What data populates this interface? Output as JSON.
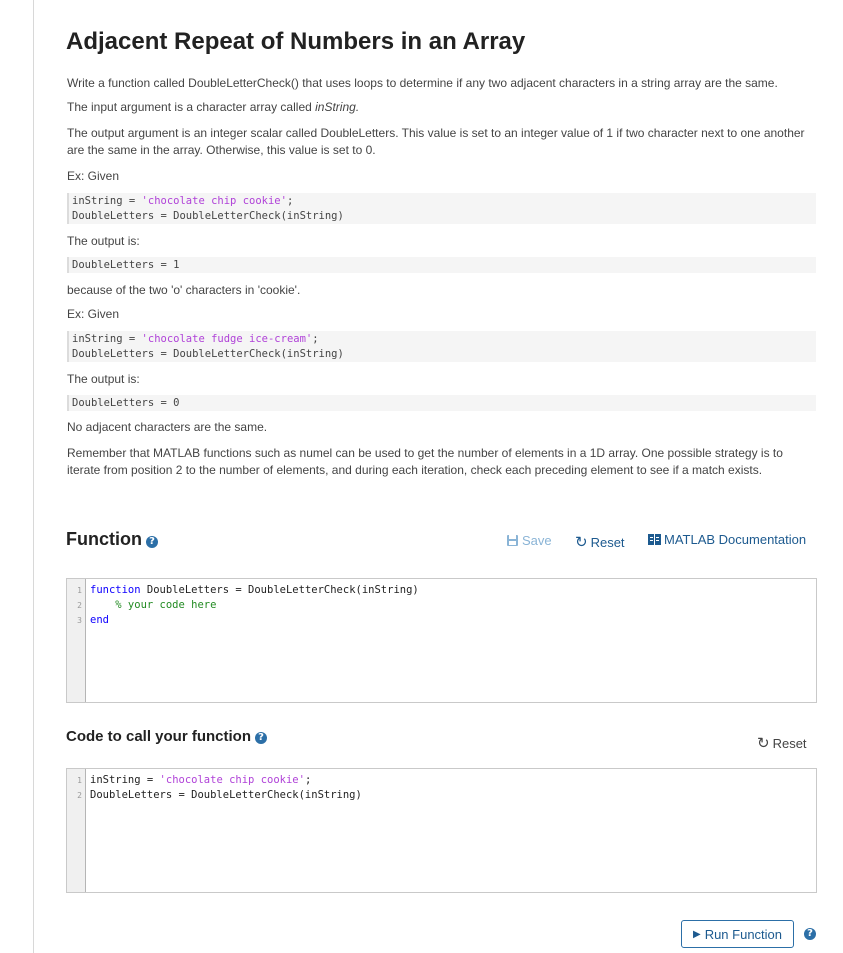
{
  "page": {
    "title": "Adjacent Repeat of Numbers in an Array",
    "para1": "Write a function called DoubleLetterCheck() that uses loops to determine if any two adjacent characters in a string array are the same.",
    "para2_prefix": "The input argument is a character array called ",
    "para2_var": "inString.",
    "para3": "The output argument is an integer scalar called DoubleLetters. This value is set to an integer value of 1 if two character next to one another are the same in the array. Otherwise, this value is set to 0.",
    "ex1_label": "Ex: Given",
    "ex1_line1_pre": "inString = ",
    "ex1_line1_str": "'chocolate chip cookie'",
    "ex1_line1_post": ";",
    "ex1_line2": "DoubleLetters = DoubleLetterCheck(inString)",
    "output1_label": "The output is:",
    "output1_code": "DoubleLetters = 1",
    "output1_note": "because of the two 'o' characters in 'cookie'.",
    "ex2_label": "Ex: Given",
    "ex2_line1_pre": "inString = ",
    "ex2_line1_str": "'chocolate fudge ice-cream'",
    "ex2_line1_post": ";",
    "ex2_line2": "DoubleLetters = DoubleLetterCheck(inString)",
    "output2_label": "The output is:",
    "output2_code": "DoubleLetters = 0",
    "output2_note": "No adjacent characters are the same.",
    "para_final": "Remember that MATLAB functions such as numel can be used to get the number of elements in a 1D array. One possible strategy is to iterate from position 2 to the number of elements, and during each iteration, check each preceding element to see if a match exists."
  },
  "function_section": {
    "title": "Function",
    "help_icon": "question-circle-icon",
    "save_label": "Save",
    "reset_label": "Reset",
    "docs_label": "MATLAB Documentation",
    "line_numbers": [
      "1",
      "2",
      "3"
    ],
    "line1_kw": "function",
    "line1_rest": " DoubleLetters = DoubleLetterCheck(inString)",
    "line2_comment": "    % your code here",
    "line3_kw": "end"
  },
  "call_section": {
    "title": "Code to call your function",
    "reset_label": "Reset",
    "line_numbers": [
      "1",
      "2"
    ],
    "line1_pre": "inString = ",
    "line1_str": "'chocolate chip cookie'",
    "line1_post": ";",
    "line2": "DoubleLetters = DoubleLetterCheck(inString)"
  },
  "run_button": {
    "label": "Run Function"
  },
  "colors": {
    "accent": "#1d5a8f",
    "help": "#2c6fa7",
    "string": "#b042d8",
    "keyword": "#0e00ff",
    "comment": "#228b22"
  }
}
